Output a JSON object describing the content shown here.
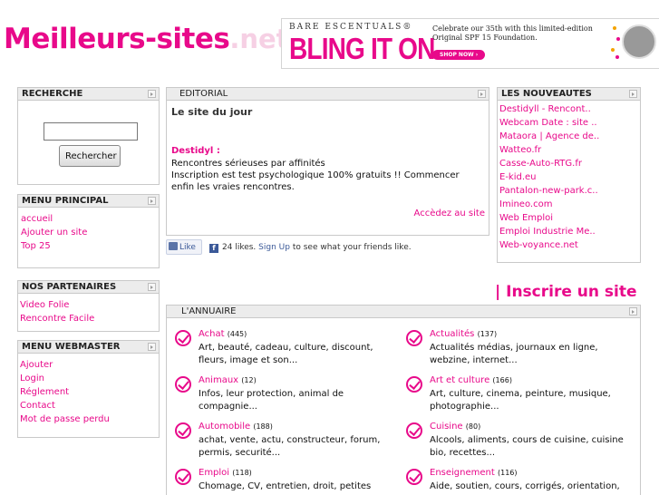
{
  "site": {
    "logo_main": "Meilleurs-sites",
    "logo_tld": ".net"
  },
  "banner": {
    "brand": "BARE ESCENTUALS®",
    "slogan": "BLING IT ON.",
    "promo": "Celebrate our 35th with this limited-edition Original SPF 15 Foundation.",
    "cta": "SHOP NOW ›"
  },
  "recherche": {
    "title": "RECHERCHE",
    "input_value": "",
    "button": "Rechercher"
  },
  "menu_principal": {
    "title": "MENU PRINCIPAL",
    "items": [
      "accueil",
      "Ajouter un site",
      "Top 25"
    ]
  },
  "partenaires": {
    "title": "NOS PARTENAIRES",
    "items": [
      "Video Folie",
      "Rencontre Facile"
    ]
  },
  "webmaster": {
    "title": "MENU WEBMASTER",
    "items": [
      "Ajouter",
      "Login",
      "Réglement",
      "Contact",
      "Mot de passe perdu"
    ]
  },
  "editorial": {
    "title": "EDITORIAL",
    "heading": "Le site du jour",
    "site_name": "Destidyl :",
    "line1": "Rencontres sérieuses par affinités",
    "line2": "Inscription est test psychologique 100% gratuits !! Commencer enfin les vraies rencontres.",
    "more": "Accèdez au site"
  },
  "facebook": {
    "like": "Like",
    "likes_text": "24 likes.",
    "signup": "Sign Up",
    "after": "to see what your friends like."
  },
  "nouveautes": {
    "title": "LES NOUVEAUTES",
    "items": [
      "Destidyll - Rencont..",
      "Webcam Date : site ..",
      "Mataora | Agence de..",
      "Watteo.fr",
      "Casse-Auto-RTG.fr",
      "E-kid.eu",
      "Pantalon-new-park.c..",
      "Imineo.com",
      "Web Emploi",
      "Emploi Industrie Me..",
      "Web-voyance.net"
    ]
  },
  "inscrire": "| Inscrire un site",
  "annuaire": {
    "title": "L'ANNUAIRE",
    "categories": [
      {
        "name": "Achat",
        "count": "(445)",
        "desc": "Art, beauté, cadeau, culture, discount, fleurs, image et son..."
      },
      {
        "name": "Actualités",
        "count": "(137)",
        "desc": "Actualités médias, journaux en ligne, webzine, internet..."
      },
      {
        "name": "Animaux",
        "count": "(12)",
        "desc": "Infos, leur protection, animal de compagnie..."
      },
      {
        "name": "Art et culture",
        "count": "(166)",
        "desc": "Art, culture, cinema, peinture, musique, photographie..."
      },
      {
        "name": "Automobile",
        "count": "(188)",
        "desc": "achat, vente, actu, constructeur, forum, permis, securité..."
      },
      {
        "name": "Cuisine",
        "count": "(80)",
        "desc": "Alcools, aliments, cours de cuisine, cuisine bio, recettes..."
      },
      {
        "name": "Emploi",
        "count": "(118)",
        "desc": "Chomage, CV, entretien, droit, petites"
      },
      {
        "name": "Enseignement",
        "count": "(116)",
        "desc": "Aide, soutien, cours, corrigés, orientation,"
      }
    ]
  },
  "colors": {
    "brand_pink": "#e8098a",
    "header_bg": "#ececec",
    "border": "#c9c9c9"
  }
}
